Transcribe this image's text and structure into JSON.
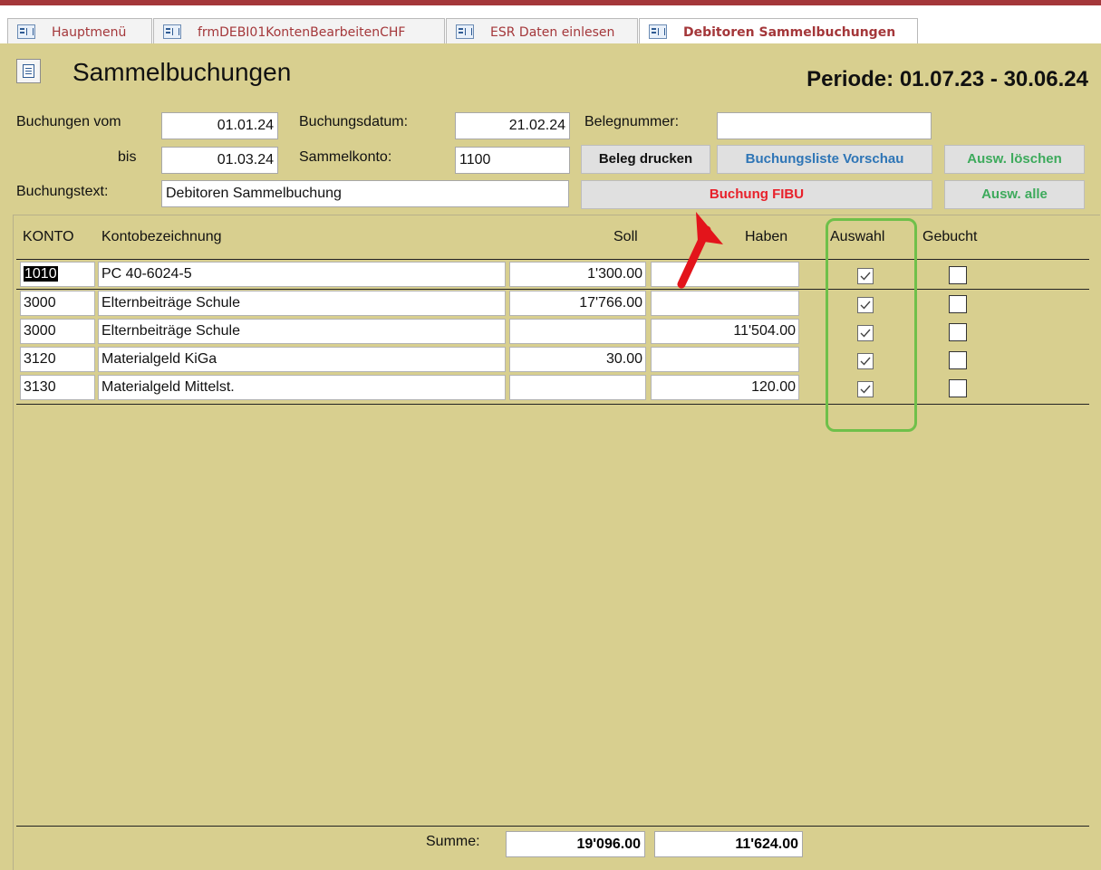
{
  "tabs": [
    {
      "label": "Hauptmenü",
      "active": false
    },
    {
      "label": "frmDEBI01KontenBearbeitenCHF",
      "active": false
    },
    {
      "label": "ESR Daten einlesen",
      "active": false
    },
    {
      "label": "Debitoren Sammelbuchungen",
      "active": true
    }
  ],
  "header": {
    "title": "Sammelbuchungen",
    "periode": "Periode: 01.07.23 - 30.06.24"
  },
  "filters": {
    "buchungen_vom_label": "Buchungen vom",
    "buchungen_vom_value": "01.01.24",
    "bis_label": "bis",
    "bis_value": "01.03.24",
    "buchungsdatum_label": "Buchungsdatum:",
    "buchungsdatum_value": "21.02.24",
    "sammelkonto_label": "Sammelkonto:",
    "sammelkonto_value": "1100",
    "belegnummer_label": "Belegnummer:",
    "belegnummer_value": "",
    "buchungstext_label": "Buchungstext:",
    "buchungstext_value": "Debitoren Sammelbuchung"
  },
  "buttons": {
    "beleg_drucken": "Beleg drucken",
    "buchungsliste_vorschau": "Buchungsliste Vorschau",
    "ausw_loeschen": "Ausw. löschen",
    "buchung_fibu": "Buchung FIBU",
    "ausw_alle": "Ausw. alle"
  },
  "columns": {
    "konto": "KONTO",
    "kontobezeichnung": "Kontobezeichnung",
    "soll": "Soll",
    "haben": "Haben",
    "auswahl": "Auswahl",
    "gebucht": "Gebucht"
  },
  "rows": [
    {
      "konto": "1010",
      "bezeichnung": "PC 40-6024-5",
      "soll": "1'300.00",
      "haben": "",
      "auswahl": true,
      "gebucht": false
    },
    {
      "konto": "3000",
      "bezeichnung": "Elternbeiträge Schule",
      "soll": "17'766.00",
      "haben": "",
      "auswahl": true,
      "gebucht": false
    },
    {
      "konto": "3000",
      "bezeichnung": "Elternbeiträge Schule",
      "soll": "",
      "haben": "11'504.00",
      "auswahl": true,
      "gebucht": false
    },
    {
      "konto": "3120",
      "bezeichnung": "Materialgeld KiGa",
      "soll": "30.00",
      "haben": "",
      "auswahl": true,
      "gebucht": false
    },
    {
      "konto": "3130",
      "bezeichnung": "Materialgeld Mittelst.",
      "soll": "",
      "haben": "120.00",
      "auswahl": true,
      "gebucht": false
    }
  ],
  "footer": {
    "summe_label": "Summe:",
    "summe_soll": "19'096.00",
    "summe_haben": "11'624.00"
  },
  "colors": {
    "form_background": "#d8cf8f",
    "tab_text": "#a4373a",
    "buchung_fibu_text": "#e8202a",
    "vorschau_text": "#2e75b6",
    "ausw_text": "#3daa5c",
    "highlight_box": "#6fc04a",
    "annotation_arrow": "#e3141b"
  }
}
